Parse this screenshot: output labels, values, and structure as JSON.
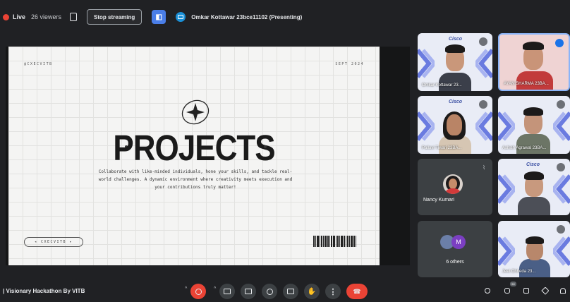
{
  "topbar": {
    "live_label": "Live",
    "viewers": "26 viewers",
    "stop_button": "Stop streaming",
    "presenting_text": "Omkar Kottawar 23bce11102 (Presenting)",
    "live_color": "#ea4335",
    "accent": "#4a7ee8"
  },
  "slide": {
    "brand": "@CXECVITB",
    "date": "SEPT 2024",
    "title": "PROJECTS",
    "body": "Collaborate with like-minded individuals, hone your skills, and tackle real-world challenges. A dynamic environment where creativity meets execution and your contributions truly matter!",
    "pill": "CXECVITB",
    "logo_icon": "sparkle-ring-icon",
    "barcode_icon": "barcode-icon"
  },
  "participants": [
    {
      "name": "Omkar Kottawar 23...",
      "variant": "video"
    },
    {
      "name": "AYAN SHARMA 23BA...",
      "variant": "video"
    },
    {
      "name": "Pallavi Tiwari 23BA...",
      "variant": "video"
    },
    {
      "name": "Ashish Agrawal 23BA...",
      "variant": "video"
    },
    {
      "name": "Nancy Kumari",
      "variant": "avatar"
    },
    {
      "name": "",
      "variant": "video"
    },
    {
      "name": "6 others",
      "variant": "others",
      "avatar_letter": "M"
    },
    {
      "name": "Jeet Chheda 23...",
      "variant": "video"
    }
  ],
  "tile_logo": "Cisco",
  "bottombar": {
    "meeting_name": "| Visionary Hackathon By VITB",
    "people_count": "50"
  }
}
